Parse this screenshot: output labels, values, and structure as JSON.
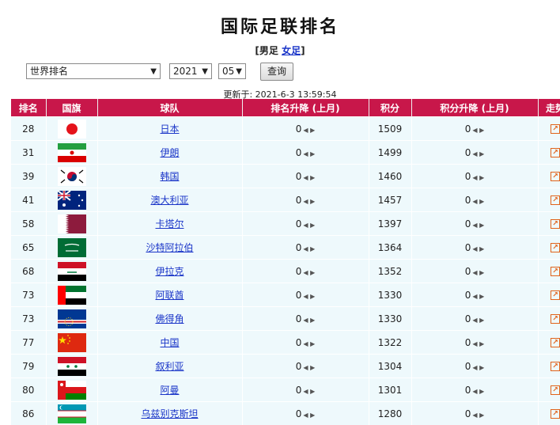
{
  "page": {
    "title": "国际足联排名",
    "gender_open": "[",
    "gender_male": "男足",
    "gender_female": "女足",
    "gender_close": "]",
    "updated_label": "更新于: 2021-6-3 13:59:54"
  },
  "controls": {
    "ranking_type": "世界排名",
    "year": "2021",
    "month": "05",
    "query_button": "查询"
  },
  "table": {
    "headers": [
      "排名",
      "国旗",
      "球队",
      "排名升降 (上月)",
      "积分",
      "积分升降 (上月)",
      "走势"
    ],
    "rows": [
      {
        "rank": "28",
        "flag": "japan-flag",
        "team": "日本",
        "rank_change": "0",
        "points": "1509",
        "points_change": "0"
      },
      {
        "rank": "31",
        "flag": "iran-flag",
        "team": "伊朗",
        "rank_change": "0",
        "points": "1499",
        "points_change": "0"
      },
      {
        "rank": "39",
        "flag": "korea-flag",
        "team": "韩国",
        "rank_change": "0",
        "points": "1460",
        "points_change": "0"
      },
      {
        "rank": "41",
        "flag": "australia-flag",
        "team": "澳大利亚",
        "rank_change": "0",
        "points": "1457",
        "points_change": "0"
      },
      {
        "rank": "58",
        "flag": "qatar-flag",
        "team": "卡塔尔",
        "rank_change": "0",
        "points": "1397",
        "points_change": "0"
      },
      {
        "rank": "65",
        "flag": "saudi-flag",
        "team": "沙特阿拉伯",
        "rank_change": "0",
        "points": "1364",
        "points_change": "0"
      },
      {
        "rank": "68",
        "flag": "iraq-flag",
        "team": "伊拉克",
        "rank_change": "0",
        "points": "1352",
        "points_change": "0"
      },
      {
        "rank": "73",
        "flag": "uae-flag",
        "team": "阿联酋",
        "rank_change": "0",
        "points": "1330",
        "points_change": "0"
      },
      {
        "rank": "73",
        "flag": "capeverde-flag",
        "team": "佛得角",
        "rank_change": "0",
        "points": "1330",
        "points_change": "0"
      },
      {
        "rank": "77",
        "flag": "china-flag",
        "team": "中国",
        "rank_change": "0",
        "points": "1322",
        "points_change": "0"
      },
      {
        "rank": "79",
        "flag": "syria-flag",
        "team": "叙利亚",
        "rank_change": "0",
        "points": "1304",
        "points_change": "0"
      },
      {
        "rank": "80",
        "flag": "oman-flag",
        "team": "阿曼",
        "rank_change": "0",
        "points": "1301",
        "points_change": "0"
      },
      {
        "rank": "86",
        "flag": "uzbekistan-flag",
        "team": "乌兹别克斯坦",
        "rank_change": "0",
        "points": "1280",
        "points_change": "0"
      }
    ]
  },
  "colors": {
    "header_bg": "#c8174a",
    "row_bg": "#eef9fc",
    "link": "#1a35c8",
    "trend_icon": "#e0631a"
  }
}
